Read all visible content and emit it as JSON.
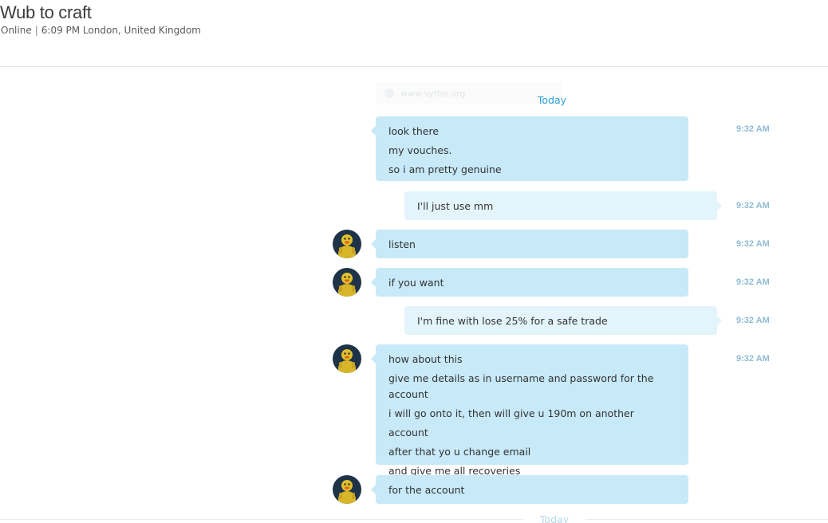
{
  "header": {
    "contact_name": "Wub to craft",
    "status": "Online",
    "local_time": "6:09 PM London, United Kingdom"
  },
  "conversation": {
    "faded_link": "www.sythe.org",
    "day_label_top": "Today",
    "day_label_bottom": "Today",
    "messages": [
      {
        "direction": "incoming",
        "avatar": false,
        "time": "9:32 AM",
        "lines": [
          "look there",
          "my vouches.",
          "so i am pretty genuine"
        ]
      },
      {
        "direction": "outgoing",
        "avatar": false,
        "time": "9:32 AM",
        "lines": [
          "I'll just use mm"
        ]
      },
      {
        "direction": "incoming",
        "avatar": true,
        "time": "9:32 AM",
        "lines": [
          "listen"
        ]
      },
      {
        "direction": "incoming",
        "avatar": true,
        "time": "9:32 AM",
        "lines": [
          "if you want"
        ]
      },
      {
        "direction": "outgoing",
        "avatar": false,
        "time": "9:32 AM",
        "lines": [
          "I'm fine with lose 25% for a safe trade"
        ]
      },
      {
        "direction": "incoming",
        "avatar": true,
        "time": "9:32 AM",
        "lines": [
          "how about this",
          "give me details as in username and password for the account",
          "i will go onto it, then will give u 190m on another account",
          "after that yo u change email",
          "and give me all recoveries"
        ]
      },
      {
        "direction": "incoming",
        "avatar": true,
        "time": "",
        "lines": [
          "for the account"
        ]
      }
    ]
  },
  "colors": {
    "incoming_bubble": "#c7e9f8",
    "outgoing_bubble": "#e3f4fb",
    "timestamp": "#8fbcd4",
    "day_label": "#2a9fd6"
  }
}
